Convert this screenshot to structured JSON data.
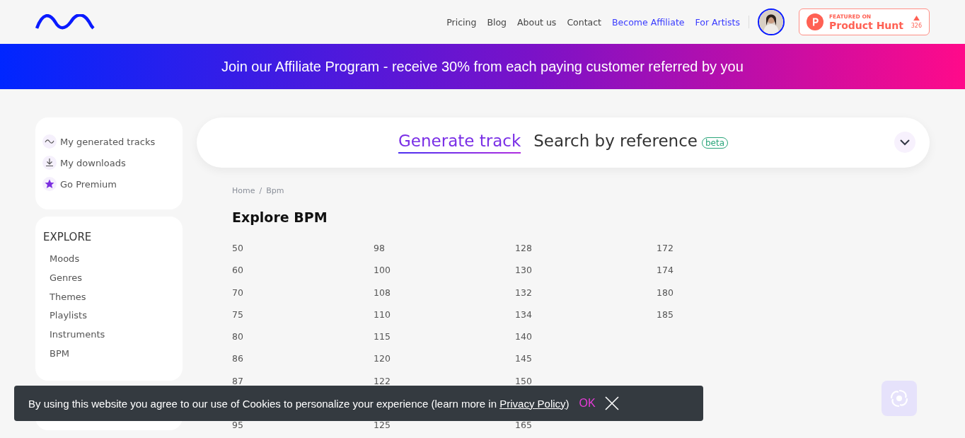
{
  "header": {
    "nav": [
      {
        "label": "Pricing",
        "kind": "plain"
      },
      {
        "label": "Blog",
        "kind": "plain"
      },
      {
        "label": "About us",
        "kind": "plain"
      },
      {
        "label": "Contact",
        "kind": "plain"
      },
      {
        "label": "Become Affiliate",
        "kind": "accent"
      },
      {
        "label": "For Artists",
        "kind": "accent"
      }
    ],
    "badge": {
      "small": "FEATURED ON",
      "name": "Product Hunt",
      "count": "326"
    }
  },
  "promo_banner": {
    "text": "Join our Affiliate Program - receive 30% from each paying customer referred by you"
  },
  "sidebar": {
    "user_links": [
      {
        "label": "My generated tracks",
        "kind": "wave"
      },
      {
        "label": "My downloads",
        "kind": "download"
      },
      {
        "label": "Go Premium",
        "kind": "star"
      }
    ],
    "explore": {
      "title": "EXPLORE",
      "items": [
        "Moods",
        "Genres",
        "Themes",
        "Playlists",
        "Instruments",
        "BPM"
      ]
    }
  },
  "tabs": [
    {
      "label": "Generate track",
      "selected": true
    },
    {
      "label": "Search by reference",
      "selected": false,
      "badge": "beta"
    }
  ],
  "breadcrumb": {
    "items": [
      "Home",
      "Bpm"
    ],
    "separator": "/"
  },
  "page_title": "Explore BPM",
  "bpm_columns": [
    {
      "values": [
        "50",
        "60",
        "70",
        "75",
        "80",
        "86",
        "87"
      ],
      "values_below_banner": [
        "95"
      ]
    },
    {
      "values": [
        "98",
        "100",
        "108",
        "110",
        "115",
        "120",
        "122"
      ],
      "values_below_banner": [
        "125"
      ]
    },
    {
      "values": [
        "128",
        "130",
        "132",
        "134",
        "140",
        "145",
        "150"
      ],
      "values_below_banner": [
        "165"
      ]
    },
    {
      "values": [
        "172",
        "174",
        "180",
        "185"
      ]
    }
  ],
  "cookie_banner": {
    "text": "By using this website you agree to our use of Cookies to personalize your experience (learn more in ",
    "link": "Privacy Policy",
    "after": ")",
    "ok": "OK"
  }
}
